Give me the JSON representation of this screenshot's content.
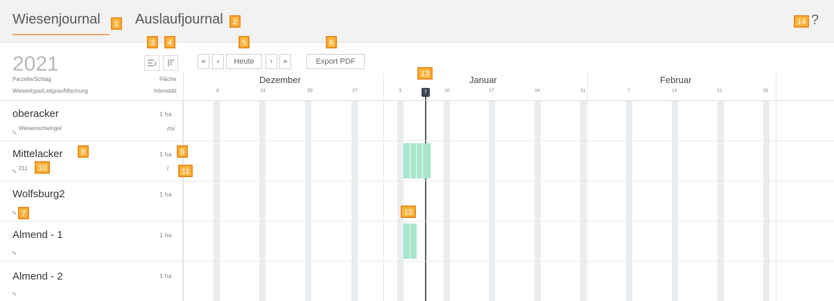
{
  "tabs": [
    {
      "label": "Wiesenjournal",
      "badge": "1"
    },
    {
      "label": "Auslaufjournal",
      "badge": "2"
    }
  ],
  "help": {
    "label": "?",
    "badge": "14"
  },
  "year": "2021",
  "toolbar": {
    "sort_icon_badge": "3",
    "filter_icon_badge": "4",
    "nav_badge": "5",
    "first_label": "«",
    "prev_label": "‹",
    "today_label": "Heute",
    "next_label": "›",
    "last_label": "»",
    "export_label": "Export PDF",
    "export_badge": "6"
  },
  "columns": {
    "parcel": "Parzelle/Schlag",
    "type": "Wiesentype/Leitgras/Mischung",
    "area": "Fläche",
    "intensity": "Intensität"
  },
  "calendar": {
    "months": [
      "Dezember",
      "Januar",
      "Februar"
    ],
    "dec_days": [
      "6",
      "13",
      "20",
      "27"
    ],
    "jan_days": [
      "3",
      "10",
      "17",
      "24",
      "31"
    ],
    "feb_days": [
      "7",
      "14",
      "21",
      "28"
    ],
    "today": "7",
    "today_badge": "13"
  },
  "rows": [
    {
      "name": "oberacker",
      "area": "1 ha",
      "sub": "Wiesenschwingel",
      "intensity": "mi"
    },
    {
      "name": "Mittelacker",
      "area": "1 ha",
      "sub": "211",
      "intensity": "i",
      "name_badge": "8",
      "area_badge": "9",
      "sub_badge": "10",
      "int_badge": "11"
    },
    {
      "name": "Wolfsburg2",
      "area": "1 ha",
      "sub": "",
      "intensity": "",
      "edit_badge": "7"
    },
    {
      "name": "Almend - 1",
      "area": "1 ha",
      "sub": "",
      "intensity": ""
    },
    {
      "name": "Almend - 2",
      "area": "1 ha",
      "sub": "",
      "intensity": ""
    }
  ],
  "events_badge": "12",
  "icons": {
    "sort": "sort-lines-icon",
    "filter": "filter-bars-icon",
    "edit": "pencil-icon"
  }
}
